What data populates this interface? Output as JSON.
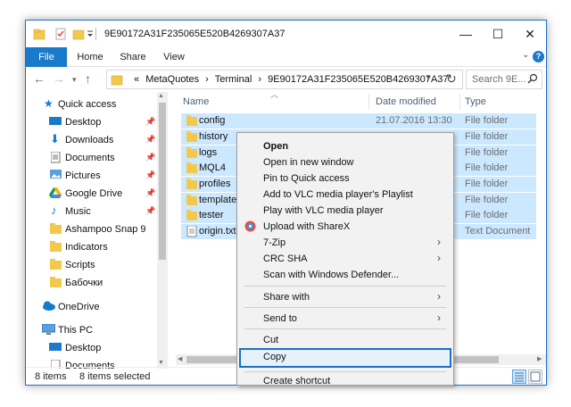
{
  "window": {
    "title": "9E90172A31F235065E520B4269307A37",
    "controls": {
      "minimize": "—",
      "maximize": "☐",
      "close": "✕"
    }
  },
  "ribbon": {
    "tabs": [
      "File",
      "Home",
      "Share",
      "View"
    ]
  },
  "address": {
    "prefix": "«",
    "crumbs": [
      "MetaQuotes",
      "›",
      "Terminal",
      "›",
      "9E90172A31F235065E520B4269307A37"
    ],
    "search_placeholder": "Search 9E..."
  },
  "nav": {
    "items": [
      {
        "label": "Quick access",
        "icon": "star-icon",
        "pinned": false
      },
      {
        "label": "Desktop",
        "icon": "desktop-icon",
        "pinned": true
      },
      {
        "label": "Downloads",
        "icon": "download-icon",
        "pinned": true
      },
      {
        "label": "Documents",
        "icon": "documents-icon",
        "pinned": true
      },
      {
        "label": "Pictures",
        "icon": "pictures-icon",
        "pinned": true
      },
      {
        "label": "Google Drive",
        "icon": "google-drive-icon",
        "pinned": true
      },
      {
        "label": "Music",
        "icon": "music-icon",
        "pinned": true
      },
      {
        "label": "Ashampoo Snap 9",
        "icon": "folder-icon",
        "pinned": false
      },
      {
        "label": "Indicators",
        "icon": "folder-icon",
        "pinned": false
      },
      {
        "label": "Scripts",
        "icon": "folder-icon",
        "pinned": false
      },
      {
        "label": "Бабочки",
        "icon": "folder-icon",
        "pinned": false
      },
      {
        "label": "OneDrive",
        "icon": "onedrive-icon",
        "pinned": false
      },
      {
        "label": "This PC",
        "icon": "computer-icon",
        "pinned": false
      },
      {
        "label": "Desktop",
        "icon": "desktop-icon",
        "pinned": false
      },
      {
        "label": "Documents",
        "icon": "documents-icon",
        "pinned": false
      }
    ]
  },
  "list": {
    "columns": {
      "name": "Name",
      "date": "Date modified",
      "type": "Type"
    },
    "rows": [
      {
        "name": "config",
        "date": "21.07.2016 13:30",
        "type": "File folder",
        "icon": "folder-icon"
      },
      {
        "name": "history",
        "date": "",
        "type": "File folder",
        "icon": "folder-icon"
      },
      {
        "name": "logs",
        "date": "",
        "type": "File folder",
        "icon": "folder-icon"
      },
      {
        "name": "MQL4",
        "date": "",
        "type": "File folder",
        "icon": "folder-icon"
      },
      {
        "name": "profiles",
        "date": "",
        "type": "File folder",
        "icon": "folder-icon"
      },
      {
        "name": "templates",
        "date": "",
        "type": "File folder",
        "icon": "folder-icon"
      },
      {
        "name": "tester",
        "date": "",
        "type": "File folder",
        "icon": "folder-icon"
      },
      {
        "name": "origin.txt",
        "date": "",
        "type": "Text Document",
        "icon": "text-file-icon"
      }
    ]
  },
  "status": {
    "item_count": "8 items",
    "selected": "8 items selected"
  },
  "context_menu": {
    "items": [
      {
        "label": "Open",
        "bold": true
      },
      {
        "label": "Open in new window"
      },
      {
        "label": "Pin to Quick access"
      },
      {
        "label": "Add to VLC media player's Playlist"
      },
      {
        "label": "Play with VLC media player"
      },
      {
        "label": "Upload with ShareX",
        "icon": "sharex-icon"
      },
      {
        "label": "7-Zip",
        "submenu": true
      },
      {
        "label": "CRC SHA",
        "submenu": true
      },
      {
        "label": "Scan with Windows Defender..."
      },
      {
        "label": "Share with",
        "submenu": true
      },
      {
        "label": "Send to",
        "submenu": true
      },
      {
        "label": "Cut"
      },
      {
        "label": "Copy",
        "highlighted": true
      },
      {
        "label": "Create shortcut"
      }
    ],
    "submenu_glyph": "›"
  },
  "colors": {
    "selection": "#cce8ff",
    "accent": "#1979ca",
    "folder": "#f2c94c",
    "menu_bg": "#f2f2f2"
  }
}
